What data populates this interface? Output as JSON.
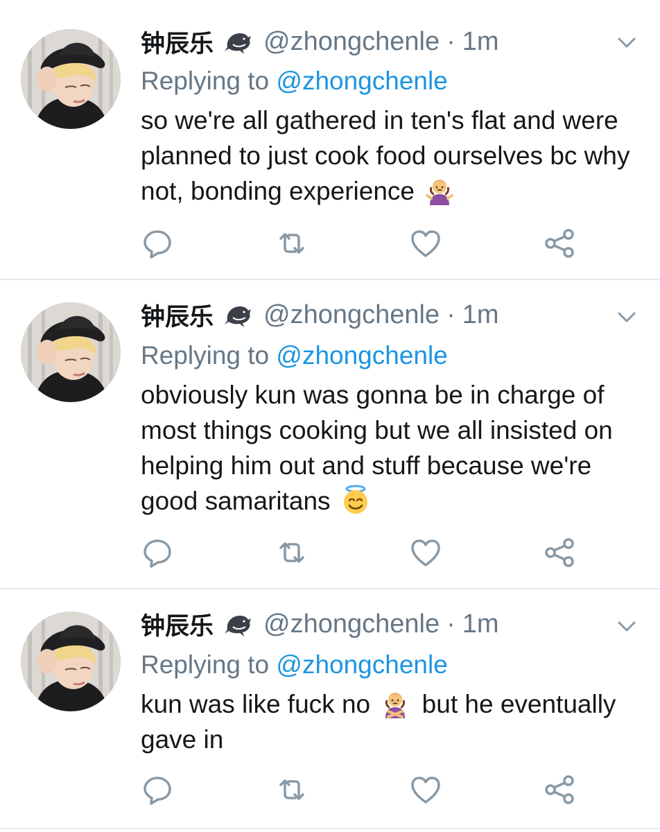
{
  "tweets": [
    {
      "display_name": "钟辰乐",
      "handle": "@zhongchenle",
      "separator": "·",
      "time": "1m",
      "replying_prefix": "Replying to",
      "replying_to": "@zhongchenle",
      "text": "so we're all gathered in ten's flat and were planned to just cook food ourselves bc why not, bonding experience",
      "emoji": "person-shrugging-emoji"
    },
    {
      "display_name": "钟辰乐",
      "handle": "@zhongchenle",
      "separator": "·",
      "time": "1m",
      "replying_prefix": "Replying to",
      "replying_to": "@zhongchenle",
      "text": "obviously kun was gonna be in charge of most things cooking but we all insisted on helping him out and stuff because we're good samaritans",
      "emoji": "smiling-face-with-halo-emoji"
    },
    {
      "display_name": "钟辰乐",
      "handle": "@zhongchenle",
      "separator": "·",
      "time": "1m",
      "replying_prefix": "Replying to",
      "replying_to": "@zhongchenle",
      "text_before_emoji": "kun was like fuck no",
      "text_after_emoji": "but he eventually gave in",
      "emoji": "person-gesturing-no-emoji"
    }
  ],
  "icons": {
    "reply": "reply-icon",
    "retweet": "retweet-icon",
    "like": "like-icon",
    "share": "share-icon",
    "caret": "chevron-down-icon",
    "badge": "dolphin-icon"
  },
  "colors": {
    "text": "#14171a",
    "secondary": "#657786",
    "link": "#1b95e0",
    "divider": "#e1e8ed"
  }
}
